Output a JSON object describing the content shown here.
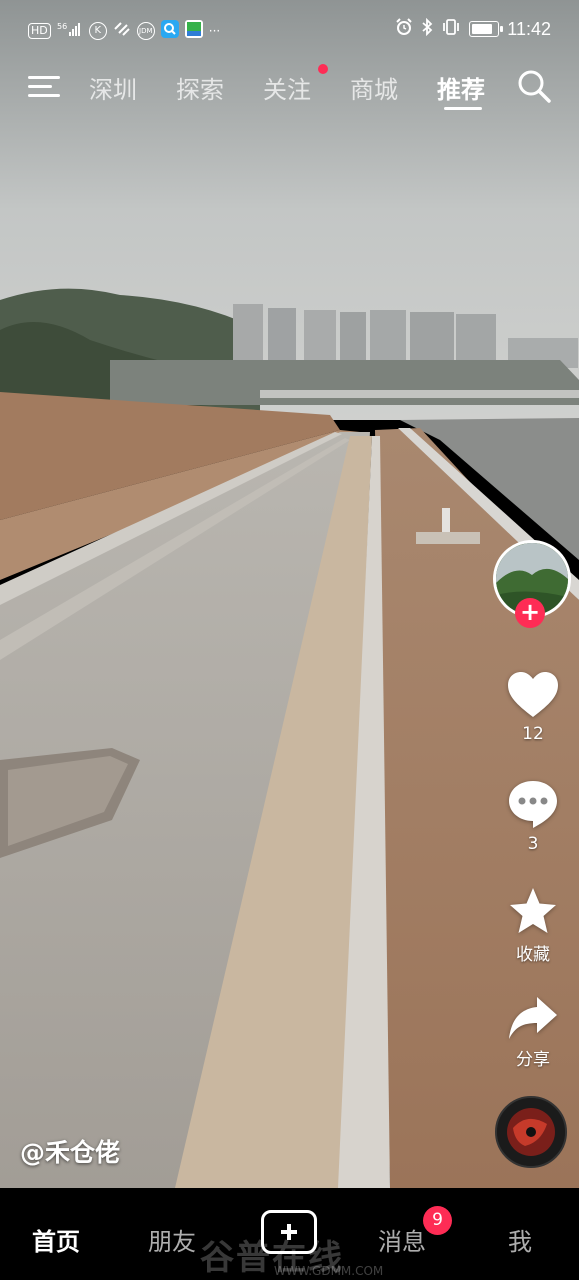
{
  "status_bar": {
    "left_icons": [
      "HD",
      "signal-icon",
      "app-icon-k",
      "app-icon-heart",
      "app-icon-jdm",
      "app-icon-search",
      "app-icon-map",
      "..."
    ],
    "hd_label": "HD",
    "network_label": "56",
    "more_label": "···",
    "time": "11:42",
    "right_icons": [
      "alarm-icon",
      "bluetooth-icon",
      "vibrate-icon",
      "battery-icon"
    ]
  },
  "top_nav": {
    "tabs": [
      {
        "label": "深圳",
        "active": false
      },
      {
        "label": "探索",
        "active": false
      },
      {
        "label": "关注",
        "active": false,
        "dot": true
      },
      {
        "label": "商城",
        "active": false
      },
      {
        "label": "推荐",
        "active": true
      }
    ]
  },
  "rail": {
    "likes": "12",
    "comments": "3",
    "favorite_label": "收藏",
    "share_label": "分享",
    "follow_symbol": "+"
  },
  "author": "@禾仓佬",
  "bottom_nav": {
    "items": [
      {
        "label": "首页",
        "active": true
      },
      {
        "label": "朋友",
        "active": false
      },
      {
        "label": "消息",
        "active": false
      },
      {
        "label": "我",
        "active": false
      }
    ],
    "message_badge": "9",
    "watermark": "谷普在线",
    "watermark_url": "WWW.GDMM.COM"
  },
  "colors": {
    "accent": "#fe2c55",
    "sky": "#b9bcbc",
    "dirt": "#a67c5e",
    "concrete": "#b1aca5"
  }
}
